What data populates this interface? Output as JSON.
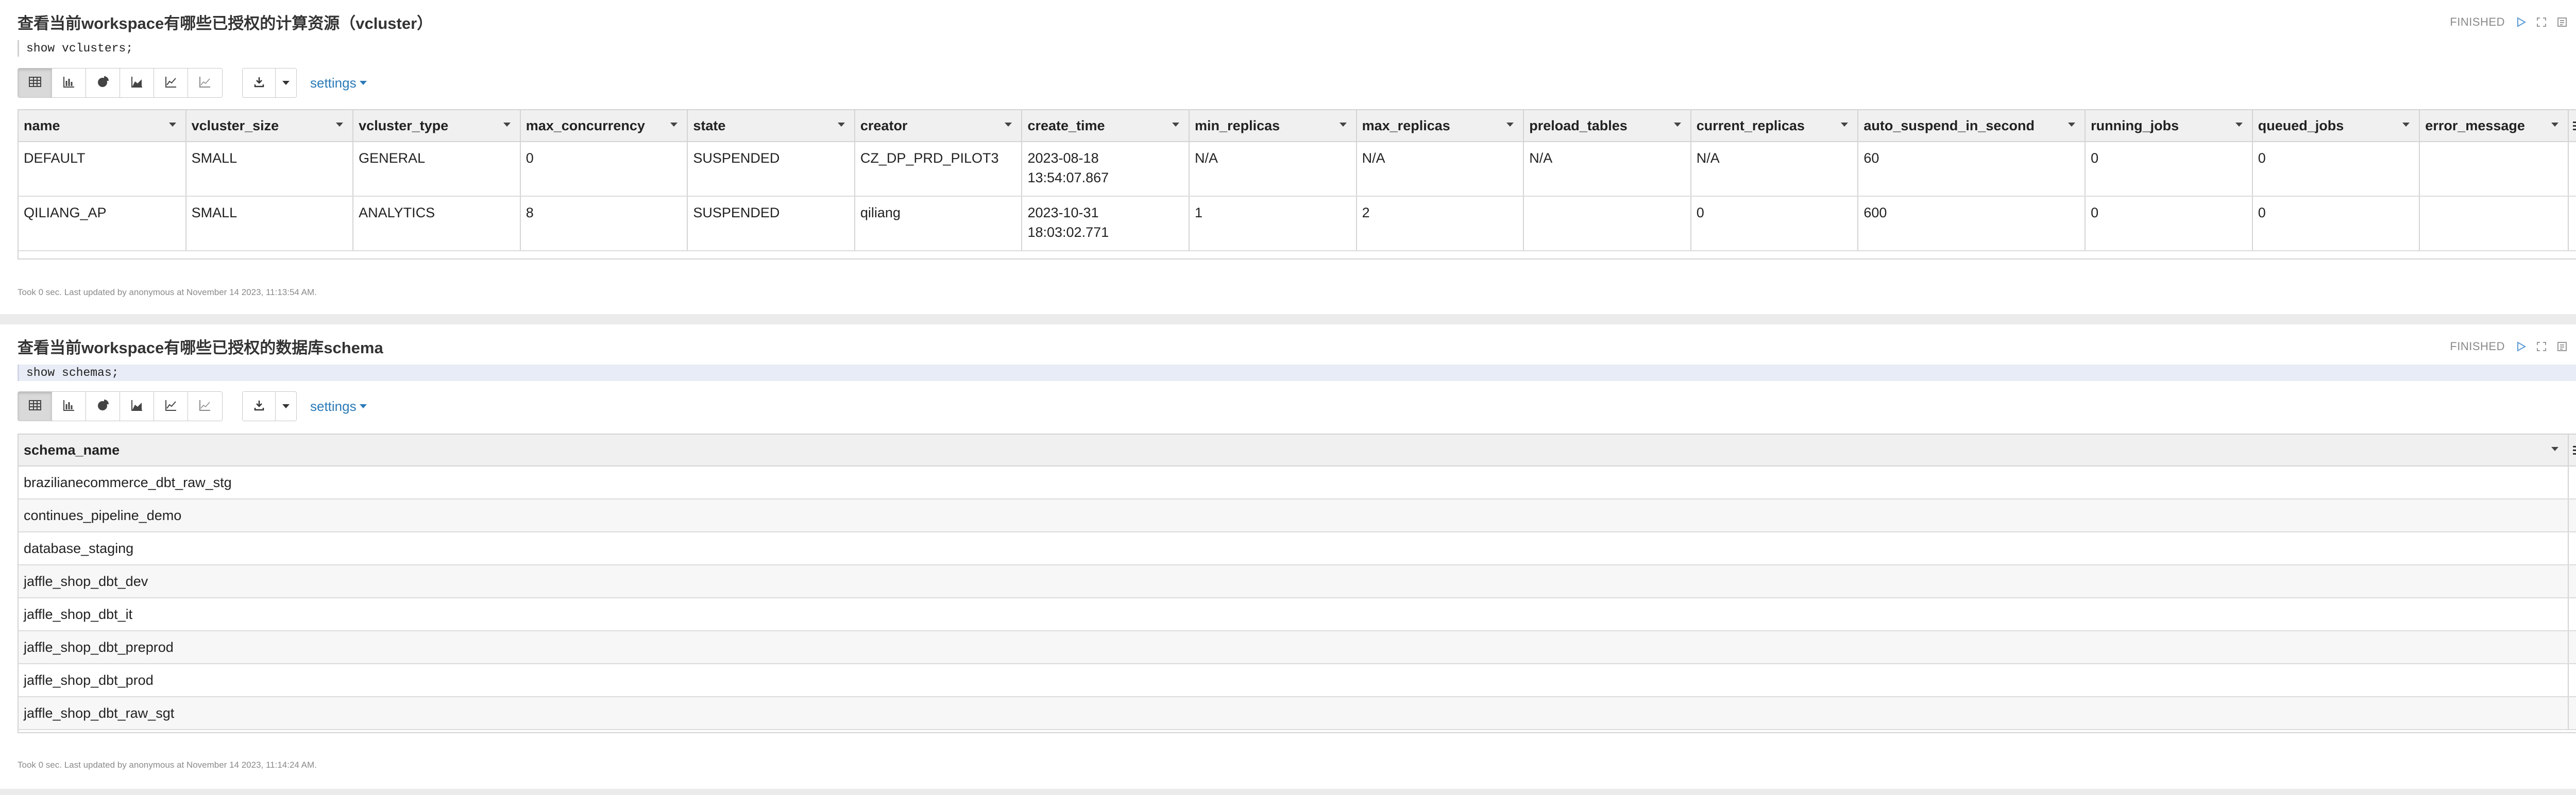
{
  "paragraphs": [
    {
      "title": "查看当前workspace有哪些已授权的计算资源（vcluster）",
      "status": "FINISHED",
      "code": "show vclusters;",
      "settings_label": "settings",
      "columns": [
        "name",
        "vcluster_size",
        "vcluster_type",
        "max_concurrency",
        "state",
        "creator",
        "create_time",
        "min_replicas",
        "max_replicas",
        "preload_tables",
        "current_replicas",
        "auto_suspend_in_second",
        "running_jobs",
        "queued_jobs",
        "error_message"
      ],
      "rows": [
        [
          "DEFAULT",
          "SMALL",
          "GENERAL",
          "0",
          "SUSPENDED",
          "CZ_DP_PRD_PILOT3",
          "2023-08-18 13:54:07.867",
          "N/A",
          "N/A",
          "N/A",
          "N/A",
          "60",
          "0",
          "0",
          ""
        ],
        [
          "QILIANG_AP",
          "SMALL",
          "ANALYTICS",
          "8",
          "SUSPENDED",
          "qiliang",
          "2023-10-31 18:03:02.771",
          "1",
          "2",
          "",
          "0",
          "600",
          "0",
          "0",
          ""
        ]
      ],
      "footer": "Took 0 sec. Last updated by anonymous at November 14 2023, 11:13:54 AM."
    },
    {
      "title": "查看当前workspace有哪些已授权的数据库schema",
      "status": "FINISHED",
      "code": "show schemas;",
      "settings_label": "settings",
      "columns": [
        "schema_name"
      ],
      "rows": [
        [
          "brazilianecommerce_dbt_raw_stg"
        ],
        [
          "continues_pipeline_demo"
        ],
        [
          "database_staging"
        ],
        [
          "jaffle_shop_dbt_dev"
        ],
        [
          "jaffle_shop_dbt_it"
        ],
        [
          "jaffle_shop_dbt_preprod"
        ],
        [
          "jaffle_shop_dbt_prod"
        ],
        [
          "jaffle_shop_dbt_raw_sgt"
        ]
      ],
      "footer": "Took 0 sec. Last updated by anonymous at November 14 2023, 11:14:24 AM."
    }
  ],
  "icons": {
    "toolbar": [
      "table-icon",
      "bar-chart-icon",
      "pie-chart-icon",
      "area-chart-icon",
      "line-chart-icon",
      "scatter-chart-icon"
    ],
    "status_controls": [
      "run-icon",
      "expand-icon",
      "book-icon",
      "gear-icon"
    ],
    "download": "download-icon"
  },
  "colors": {
    "link": "#2a7ab8",
    "run_icon": "#5b9bd5",
    "active_editor": "#e8ecf6"
  }
}
